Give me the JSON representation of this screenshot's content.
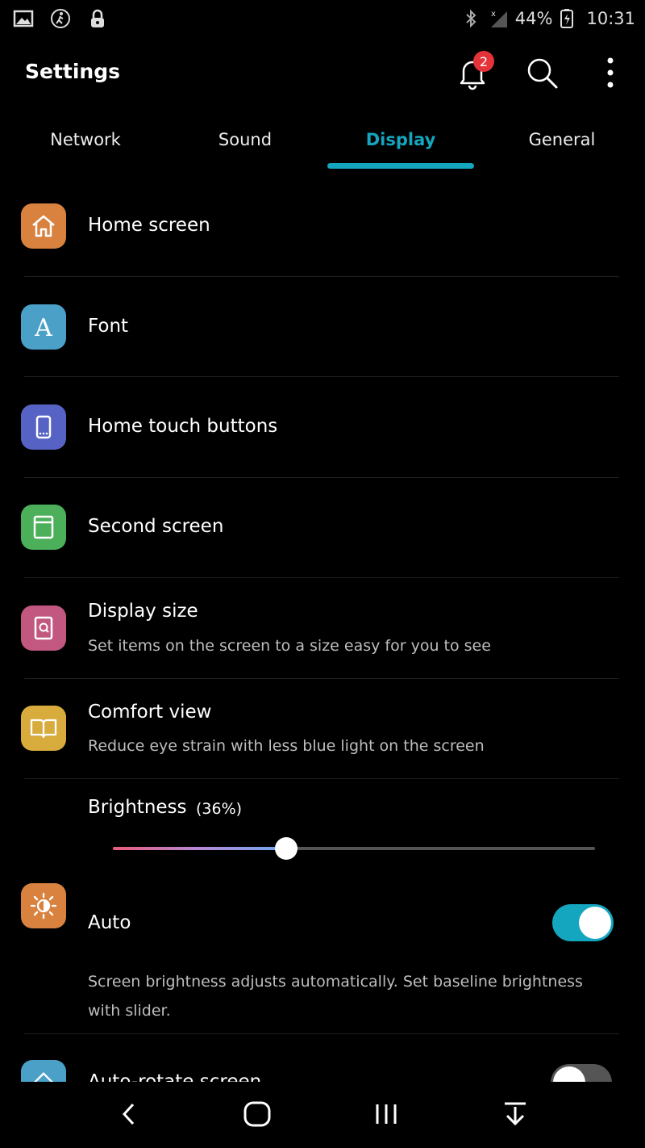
{
  "status_bar": {
    "battery": "44%",
    "time": "10:31"
  },
  "header": {
    "title": "Settings",
    "notification_count": "2"
  },
  "tabs": [
    {
      "label": "Network"
    },
    {
      "label": "Sound"
    },
    {
      "label": "Display",
      "active": true
    },
    {
      "label": "General"
    }
  ],
  "items": [
    {
      "title": "Home screen",
      "icon": "home-icon",
      "color": "#d9823f"
    },
    {
      "title": "Font",
      "icon": "font-icon",
      "color": "#4aa0c7"
    },
    {
      "title": "Home touch buttons",
      "icon": "phone-buttons-icon",
      "color": "#5763c4"
    },
    {
      "title": "Second screen",
      "icon": "second-screen-icon",
      "color": "#4caf5a"
    },
    {
      "title": "Display size",
      "subtitle": "Set items on the screen to a size easy for you to see",
      "icon": "display-size-icon",
      "color": "#c2577f"
    },
    {
      "title": "Comfort view",
      "subtitle": "Reduce eye strain with less blue light on the screen",
      "icon": "book-icon",
      "color": "#d8ab3d"
    }
  ],
  "brightness": {
    "label": "Brightness",
    "value_text": "(36%)",
    "value": 0.36
  },
  "auto": {
    "title": "Auto",
    "description": "Screen brightness adjusts automatically. Set baseline brightness with slider.",
    "enabled": true,
    "icon": "brightness-icon",
    "color": "#d9823f"
  },
  "auto_rotate": {
    "title": "Auto-rotate screen",
    "enabled": false,
    "icon": "rotate-icon",
    "color": "#4aa0c7"
  },
  "colors": {
    "accent": "#14a6bf",
    "badge": "#e5333a"
  }
}
